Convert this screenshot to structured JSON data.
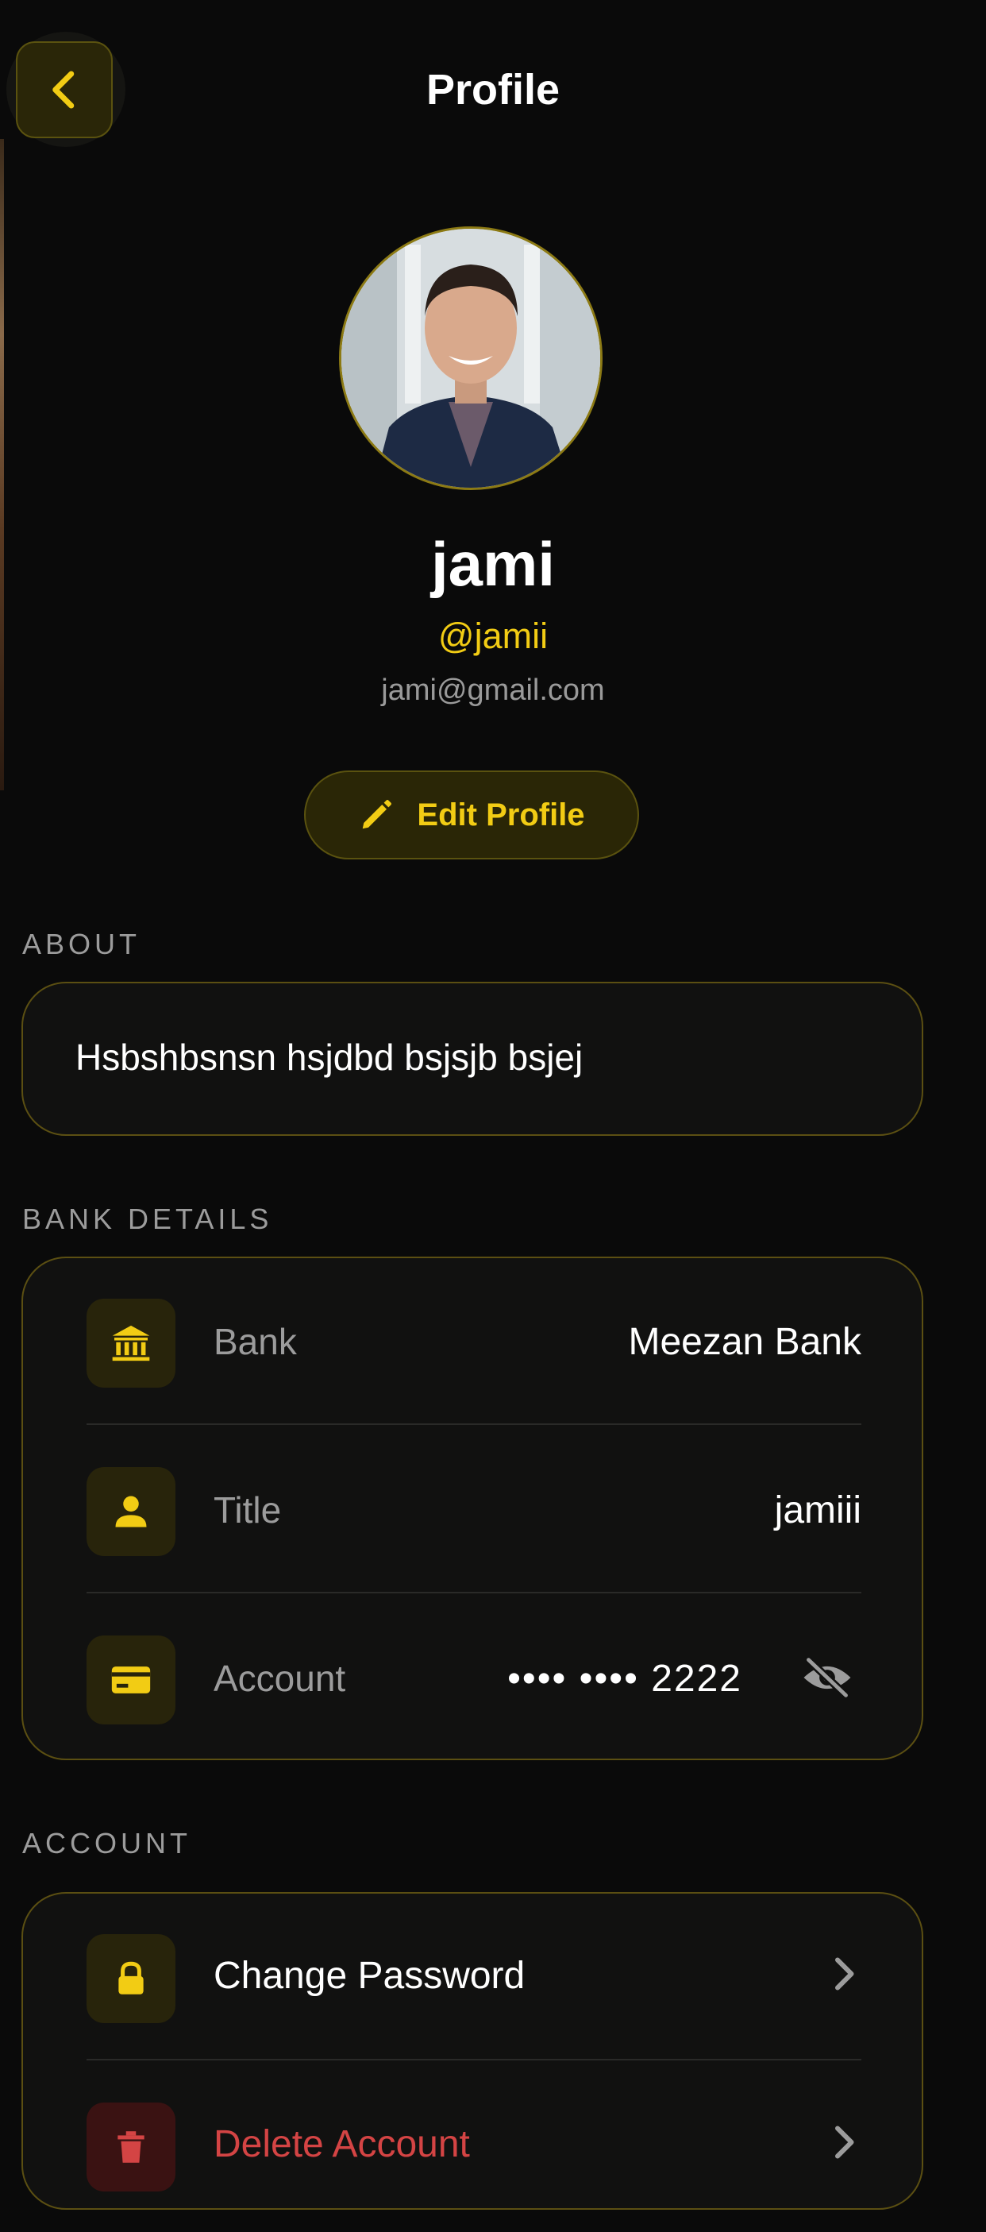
{
  "header": {
    "title": "Profile"
  },
  "profile": {
    "name": "jami",
    "handle": "@jamii",
    "email": "jami@gmail.com",
    "edit_label": "Edit Profile"
  },
  "about": {
    "section_label": "ABOUT",
    "text": "Hsbshbsnsn hsjdbd bsjsjb bsjej"
  },
  "bank_details": {
    "section_label": "BANK DETAILS",
    "rows": [
      {
        "label": "Bank",
        "value": "Meezan Bank",
        "icon": "bank-icon"
      },
      {
        "label": "Title",
        "value": "jamiii",
        "icon": "person-icon"
      },
      {
        "label": "Account",
        "value": "•••• •••• 2222",
        "icon": "card-icon"
      }
    ]
  },
  "account": {
    "section_label": "ACCOUNT",
    "change_password_label": "Change Password",
    "delete_label": "Delete Account"
  },
  "colors": {
    "accent": "#f2cc14",
    "background": "#0a0a0a",
    "card_border": "#5b4f12",
    "danger": "#d44444"
  }
}
